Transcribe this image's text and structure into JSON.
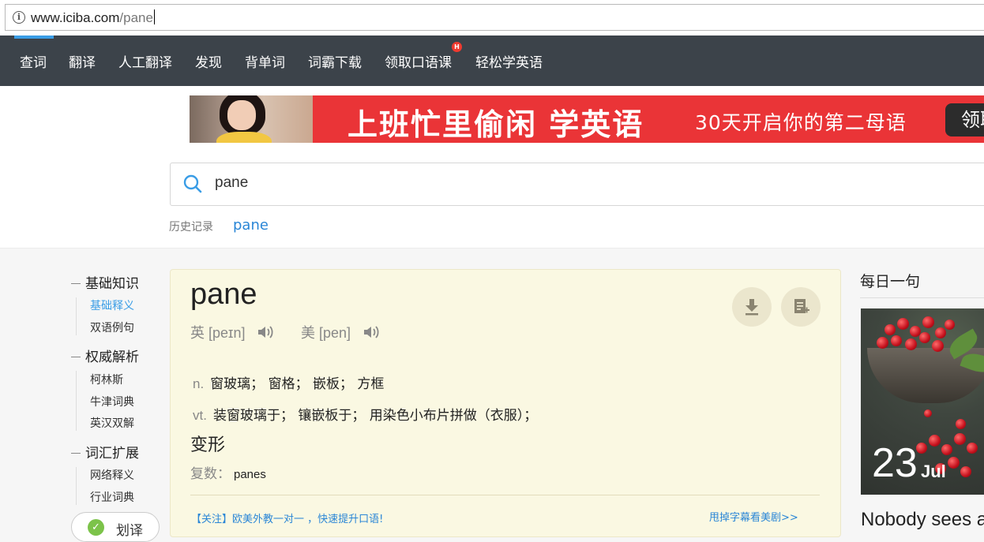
{
  "browser": {
    "url_host": "www.iciba.com",
    "url_path": "/pane",
    "info_icon": "i"
  },
  "nav": {
    "items": [
      "查词",
      "翻译",
      "人工翻译",
      "发现",
      "背单词",
      "词霸下载",
      "领取口语课",
      "轻松学英语"
    ],
    "hot_badge": "H",
    "accent": "#3a9de6",
    "background": "#3c434a"
  },
  "banner": {
    "title": "上班忙里偷闲 学英语",
    "subtitle": "30天开启你的第二母语",
    "button": "领取",
    "background": "#ea3437"
  },
  "search": {
    "value": "pane",
    "icon": "search-icon",
    "history_label": "历史记录",
    "history_items": [
      "pane"
    ]
  },
  "toc": {
    "sections": [
      {
        "title": "基础知识",
        "items": [
          "基础释义",
          "双语例句"
        ]
      },
      {
        "title": "权威解析",
        "items": [
          "柯林斯",
          "牛津词典",
          "英汉双解"
        ]
      },
      {
        "title": "词汇扩展",
        "items": [
          "网络释义",
          "行业词典"
        ]
      }
    ],
    "active_item": "基础释义",
    "huayi_label": "划译"
  },
  "entry": {
    "word": "pane",
    "uk_label": "英",
    "uk_phonetic": "[peɪn]",
    "us_label": "美",
    "us_phonetic": "[pen]",
    "definitions": [
      {
        "pos": "n.",
        "text": "窗玻璃； 窗格； 嵌板； 方框"
      },
      {
        "pos": "vt.",
        "text": "装窗玻璃于； 镶嵌板于； 用染色小布片拼做（衣服）；"
      }
    ],
    "forms_title": "变形",
    "plural_label": "复数：",
    "plural_value": "panes",
    "promo_left": "【关注】欧美外教一对一 ，快速提升口语!",
    "promo_right": "甩掉字幕看美剧>>"
  },
  "daily": {
    "title": "每日一句",
    "day": "23",
    "month": "Jul",
    "sentence_start": "Nobody sees a"
  }
}
